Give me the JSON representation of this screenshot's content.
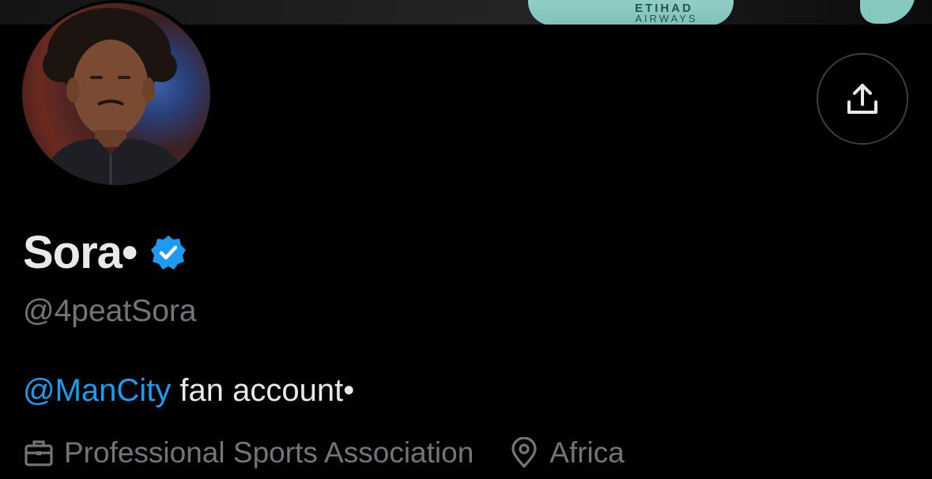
{
  "banner": {
    "sponsor_line1": "ETIHAD",
    "sponsor_line2": "AIRWAYS"
  },
  "profile": {
    "display_name": "Sora•",
    "handle": "@4peatSora",
    "verified": true,
    "verified_color": "#1d9bf0"
  },
  "bio": {
    "mention": "@ManCity",
    "text": " fan account•"
  },
  "meta": {
    "category": "Professional Sports Association",
    "location": "Africa"
  },
  "icons": {
    "share": "share-upload-icon",
    "verified": "verified-badge-icon",
    "category": "briefcase-icon",
    "location": "location-pin-icon"
  },
  "colors": {
    "background": "#000000",
    "text": "#e7e9ea",
    "muted": "#71767b",
    "link": "#1d9bf0"
  }
}
